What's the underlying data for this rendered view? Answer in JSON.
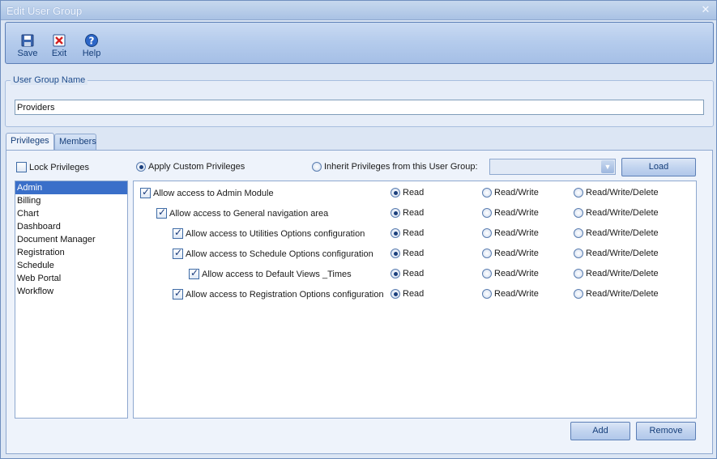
{
  "window": {
    "title": "Edit User Group"
  },
  "toolbar": {
    "save_label": "Save",
    "exit_label": "Exit",
    "help_label": "Help"
  },
  "group_name": {
    "legend": "User Group Name",
    "value": "Providers"
  },
  "tabs": [
    {
      "label": "Privileges"
    },
    {
      "label": "Members"
    }
  ],
  "privileges": {
    "lock_label": "Lock Privileges",
    "apply_label": "Apply Custom Privileges",
    "inherit_label": "Inherit Privileges from this User Group:",
    "inherit_value": "",
    "load_label": "Load",
    "add_label": "Add",
    "remove_label": "Remove",
    "modules": [
      "Admin",
      "Billing",
      "Chart",
      "Dashboard",
      "Document Manager",
      "Registration",
      "Schedule",
      "Web Portal",
      "Workflow"
    ],
    "selected_module": "Admin",
    "level_labels": [
      "Read",
      "Read/Write",
      "Read/Write/Delete"
    ],
    "rows": [
      {
        "label": "Allow access to Admin Module",
        "checked": true,
        "level": "Read"
      },
      {
        "label": "Allow access to General navigation area",
        "checked": true,
        "level": "Read"
      },
      {
        "label": "Allow access to Utilities Options configuration",
        "checked": true,
        "level": "Read"
      },
      {
        "label": "Allow access to Schedule Options configuration",
        "checked": true,
        "level": "Read"
      },
      {
        "label": "Allow access to Default Views _Times",
        "checked": true,
        "level": "Read"
      },
      {
        "label": "Allow access to Registration Options configuration",
        "checked": true,
        "level": "Read"
      }
    ]
  },
  "colors": {
    "accent": "#3a6fc9",
    "ribbon": "#b4cbec",
    "window_bg": "#dce6f4"
  }
}
